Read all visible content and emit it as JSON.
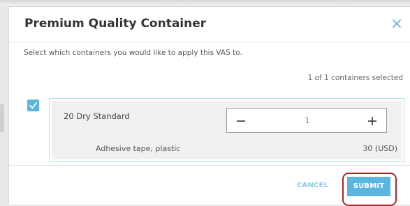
{
  "dialog": {
    "title": "Premium Quality Container",
    "instruction": "Select which containers you would like to apply this VAS to.",
    "selected_count": "1 of 1 containers selected"
  },
  "container": {
    "name": "20 Dry Standard",
    "checked": true,
    "quantity": "1",
    "vas_item": "Adhesive tape, plastic",
    "vas_price": "30 (USD)"
  },
  "actions": {
    "cancel_label": "CANCEL",
    "submit_label": "SUBMIT"
  },
  "colors": {
    "accent": "#5bb5df",
    "highlight_ring": "#b52020"
  },
  "icons": {
    "close": "close-icon",
    "checkbox": "checkmark-icon",
    "decrement": "minus-icon",
    "increment": "plus-icon"
  }
}
